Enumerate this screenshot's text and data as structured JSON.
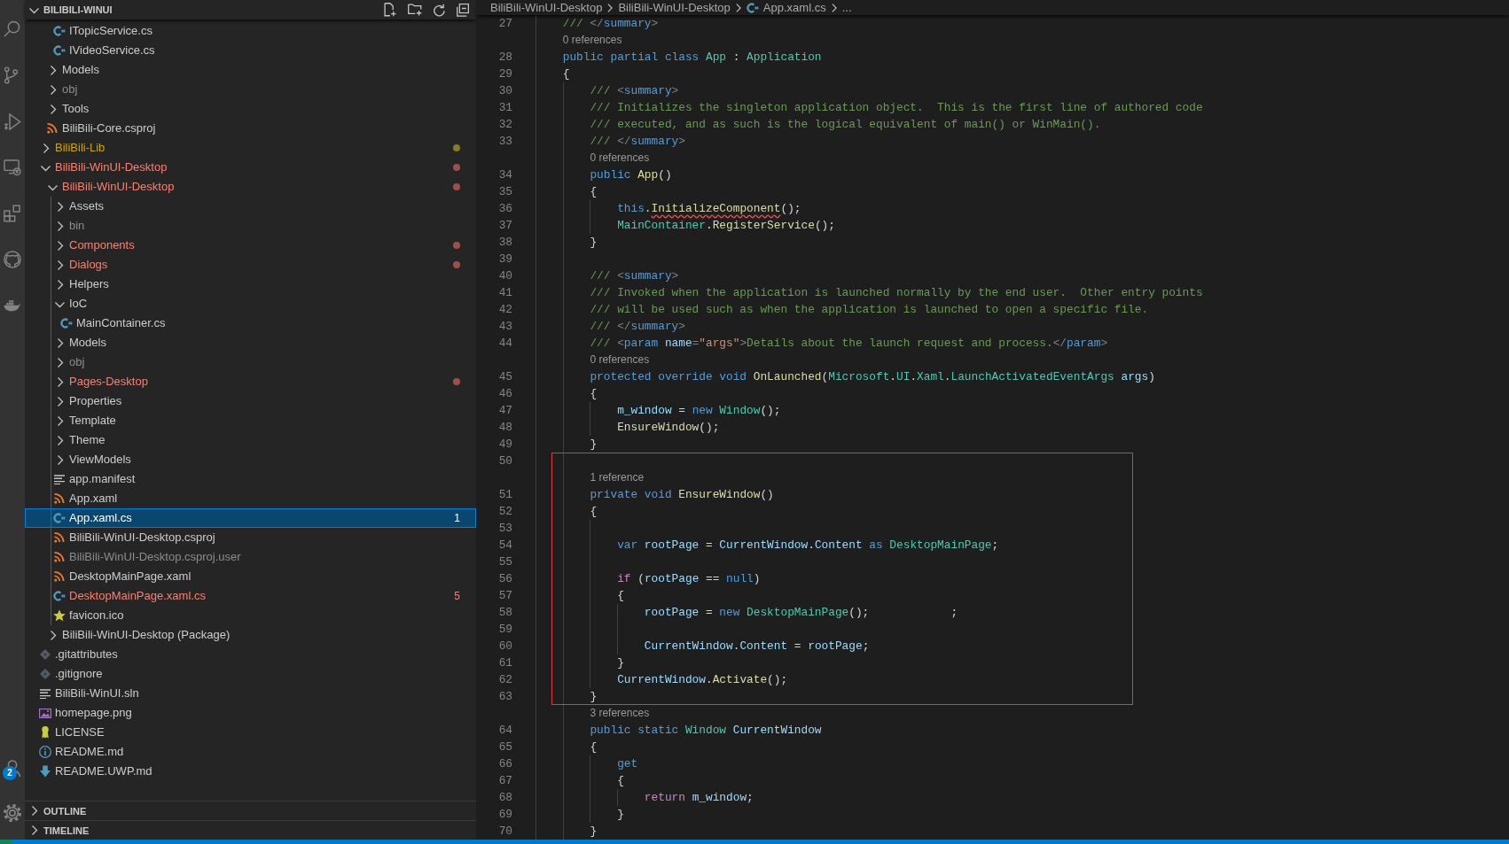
{
  "activity_bar": {
    "accounts_badge": "2"
  },
  "explorer": {
    "title": "BILIBILI-WINUI",
    "expanded": true,
    "tree": [
      {
        "kind": "offscreen",
        "children": [
          {
            "kind": "offscreen",
            "children": [
              {
                "label": "ITopicService.cs",
                "kind": "csharp",
                "selected": false,
                "errors": false,
                "warnings": false,
                "ignored": false
              },
              {
                "label": "IVideoService.cs",
                "kind": "csharp",
                "selected": false,
                "errors": false,
                "warnings": false,
                "ignored": false
              }
            ]
          },
          {
            "label": "Models",
            "kind": "folder",
            "expanded": false,
            "selected": false,
            "errors": false,
            "warnings": false,
            "ignored": false
          },
          {
            "label": "obj",
            "kind": "folder",
            "expanded": false,
            "selected": false,
            "errors": false,
            "warnings": false,
            "ignored": true
          },
          {
            "label": "Tools",
            "kind": "folder",
            "expanded": false,
            "selected": false,
            "errors": false,
            "warnings": false,
            "ignored": false
          },
          {
            "label": "BiliBili-Core.csproj",
            "kind": "xml",
            "selected": false,
            "errors": false,
            "warnings": false,
            "ignored": false
          }
        ]
      },
      {
        "label": "BiliBili-Lib",
        "kind": "folder",
        "expanded": false,
        "selected": false,
        "errors": false,
        "warnings": true,
        "ignored": false
      },
      {
        "label": "BiliBili-WinUI-Desktop",
        "kind": "folder",
        "expanded": true,
        "selected": false,
        "errors": true,
        "warnings": false,
        "ignored": false,
        "children": [
          {
            "label": "BiliBili-WinUI-Desktop",
            "kind": "folder",
            "expanded": true,
            "selected": false,
            "errors": true,
            "warnings": false,
            "ignored": false,
            "children": [
              {
                "label": "Assets",
                "kind": "folder",
                "expanded": false,
                "selected": false,
                "errors": false,
                "warnings": false,
                "ignored": false
              },
              {
                "label": "bin",
                "kind": "folder",
                "expanded": false,
                "selected": false,
                "errors": false,
                "warnings": false,
                "ignored": true
              },
              {
                "label": "Components",
                "kind": "folder",
                "expanded": false,
                "selected": false,
                "errors": true,
                "warnings": false,
                "ignored": false
              },
              {
                "label": "Dialogs",
                "kind": "folder",
                "expanded": false,
                "selected": false,
                "errors": true,
                "warnings": false,
                "ignored": false
              },
              {
                "label": "Helpers",
                "kind": "folder",
                "expanded": false,
                "selected": false,
                "errors": false,
                "warnings": false,
                "ignored": false
              },
              {
                "label": "IoC",
                "kind": "folder",
                "expanded": true,
                "selected": false,
                "errors": false,
                "warnings": false,
                "ignored": false,
                "children": [
                  {
                    "label": "MainContainer.cs",
                    "kind": "csharp",
                    "selected": false,
                    "errors": false,
                    "warnings": false,
                    "ignored": false
                  }
                ]
              },
              {
                "label": "Models",
                "kind": "folder",
                "expanded": false,
                "selected": false,
                "errors": false,
                "warnings": false,
                "ignored": false
              },
              {
                "label": "obj",
                "kind": "folder",
                "expanded": false,
                "selected": false,
                "errors": false,
                "warnings": false,
                "ignored": true
              },
              {
                "label": "Pages-Desktop",
                "kind": "folder",
                "expanded": false,
                "selected": false,
                "errors": true,
                "warnings": false,
                "ignored": false
              },
              {
                "label": "Properties",
                "kind": "folder",
                "expanded": false,
                "selected": false,
                "errors": false,
                "warnings": false,
                "ignored": false
              },
              {
                "label": "Template",
                "kind": "folder",
                "expanded": false,
                "selected": false,
                "errors": false,
                "warnings": false,
                "ignored": false
              },
              {
                "label": "Theme",
                "kind": "folder",
                "expanded": false,
                "selected": false,
                "errors": false,
                "warnings": false,
                "ignored": false
              },
              {
                "label": "ViewModels",
                "kind": "folder",
                "expanded": false,
                "selected": false,
                "errors": false,
                "warnings": false,
                "ignored": false
              },
              {
                "label": "app.manifest",
                "kind": "text",
                "selected": false,
                "errors": false,
                "warnings": false,
                "ignored": false
              },
              {
                "label": "App.xaml",
                "kind": "xml",
                "selected": false,
                "errors": false,
                "warnings": false,
                "ignored": false
              },
              {
                "label": "App.xaml.cs",
                "kind": "csharp",
                "selected": true,
                "errors": true,
                "warnings": false,
                "ignored": false,
                "badge": "1"
              },
              {
                "label": "BiliBili-WinUI-Desktop.csproj",
                "kind": "xml",
                "selected": false,
                "errors": false,
                "warnings": false,
                "ignored": false
              },
              {
                "label": "BiliBili-WinUI-Desktop.csproj.user",
                "kind": "xml",
                "selected": false,
                "errors": false,
                "warnings": false,
                "ignored": true
              },
              {
                "label": "DesktopMainPage.xaml",
                "kind": "xml",
                "selected": false,
                "errors": false,
                "warnings": false,
                "ignored": false
              },
              {
                "label": "DesktopMainPage.xaml.cs",
                "kind": "csharp",
                "selected": false,
                "errors": true,
                "warnings": false,
                "ignored": false,
                "badge": "5"
              },
              {
                "label": "favicon.ico",
                "kind": "star",
                "selected": false,
                "errors": false,
                "warnings": false,
                "ignored": false
              }
            ]
          },
          {
            "label": "BiliBili-WinUI-Desktop (Package)",
            "kind": "folder",
            "expanded": false,
            "selected": false,
            "errors": false,
            "warnings": false,
            "ignored": false
          }
        ]
      },
      {
        "label": ".gitattributes",
        "kind": "git",
        "selected": false,
        "errors": false,
        "warnings": false,
        "ignored": false
      },
      {
        "label": ".gitignore",
        "kind": "git",
        "selected": false,
        "errors": false,
        "warnings": false,
        "ignored": false
      },
      {
        "label": "BiliBili-WinUI.sln",
        "kind": "text",
        "selected": false,
        "errors": false,
        "warnings": false,
        "ignored": false
      },
      {
        "label": "homepage.png",
        "kind": "image",
        "selected": false,
        "errors": false,
        "warnings": false,
        "ignored": false
      },
      {
        "label": "LICENSE",
        "kind": "license",
        "selected": false,
        "errors": false,
        "warnings": false,
        "ignored": false
      },
      {
        "label": "README.md",
        "kind": "info",
        "selected": false,
        "errors": false,
        "warnings": false,
        "ignored": false
      },
      {
        "label": "README.UWP.md",
        "kind": "markdown",
        "selected": false,
        "errors": false,
        "warnings": false,
        "ignored": false
      }
    ],
    "panes": [
      {
        "title": "OUTLINE",
        "expanded": false
      },
      {
        "title": "TIMELINE",
        "expanded": false
      }
    ]
  },
  "editor": {
    "breadcrumbs": [
      {
        "label": "BiliBili-WinUI-Desktop",
        "kind": "folder"
      },
      {
        "label": "BiliBili-WinUI-Desktop",
        "kind": "folder"
      },
      {
        "label": "App.xaml.cs",
        "kind": "csharp"
      },
      {
        "label": "...",
        "kind": "more"
      }
    ],
    "lines": [
      {
        "kind": "offscreen",
        "children": [
          {
            "kind": "code",
            "number": "27",
            "tokens": [
              {
                "kind": "comment",
                "text": "/// "
              },
              {
                "kind": "punct",
                "text": "</"
              },
              {
                "kind": "tag",
                "text": "summary"
              },
              {
                "kind": "punct",
                "text": ">"
              }
            ]
          },
          {
            "kind": "lens",
            "text": "0 references"
          },
          {
            "kind": "code",
            "number": "28",
            "tokens": [
              {
                "kind": "kw",
                "text": "public partial class "
              },
              {
                "kind": "type",
                "text": "App"
              },
              {
                "kind": "plain",
                "text": " : "
              },
              {
                "kind": "type",
                "text": "Application"
              }
            ]
          },
          {
            "kind": "code",
            "number": "29",
            "tokens": [
              {
                "kind": "plain",
                "text": "{"
              }
            ],
            "children": [
              {
                "kind": "code",
                "number": "30",
                "tokens": [
                  {
                    "kind": "comment",
                    "text": "/// "
                  },
                  {
                    "kind": "punct",
                    "text": "<"
                  },
                  {
                    "kind": "tag",
                    "text": "summary"
                  },
                  {
                    "kind": "punct",
                    "text": ">"
                  }
                ]
              },
              {
                "kind": "code",
                "number": "31",
                "tokens": [
                  {
                    "kind": "comment",
                    "text": "/// Initializes the singleton application object.  This is the first line of authored code"
                  }
                ]
              },
              {
                "kind": "code",
                "number": "32",
                "tokens": [
                  {
                    "kind": "comment",
                    "text": "/// executed, and as such is the logical equivalent of main() or WinMain()."
                  }
                ]
              },
              {
                "kind": "code",
                "number": "33",
                "tokens": [
                  {
                    "kind": "comment",
                    "text": "/// "
                  },
                  {
                    "kind": "punct",
                    "text": "</"
                  },
                  {
                    "kind": "tag",
                    "text": "summary"
                  },
                  {
                    "kind": "punct",
                    "text": ">"
                  }
                ]
              },
              {
                "kind": "lens",
                "text": "0 references"
              },
              {
                "kind": "code",
                "number": "34",
                "tokens": [
                  {
                    "kind": "kw",
                    "text": "public "
                  },
                  {
                    "kind": "fn",
                    "text": "App"
                  },
                  {
                    "kind": "plain",
                    "text": "()"
                  }
                ]
              },
              {
                "kind": "code",
                "number": "35",
                "tokens": [
                  {
                    "kind": "plain",
                    "text": "{"
                  }
                ],
                "children": [
                  {
                    "kind": "code",
                    "number": "36",
                    "tokens": [
                      {
                        "kind": "kw",
                        "text": "this"
                      },
                      {
                        "kind": "plain",
                        "text": "."
                      },
                      {
                        "kind": "error",
                        "text": "InitializeComponent"
                      },
                      {
                        "kind": "plain",
                        "text": "();"
                      }
                    ]
                  },
                  {
                    "kind": "code",
                    "number": "37",
                    "tokens": [
                      {
                        "kind": "type",
                        "text": "MainContainer"
                      },
                      {
                        "kind": "plain",
                        "text": "."
                      },
                      {
                        "kind": "fn",
                        "text": "RegisterService"
                      },
                      {
                        "kind": "plain",
                        "text": "();"
                      }
                    ]
                  }
                ]
              },
              {
                "kind": "code",
                "number": "38",
                "tokens": [
                  {
                    "kind": "plain",
                    "text": "}"
                  }
                ]
              },
              {
                "kind": "code",
                "number": "39"
              },
              {
                "kind": "code",
                "number": "40",
                "tokens": [
                  {
                    "kind": "comment",
                    "text": "/// "
                  },
                  {
                    "kind": "punct",
                    "text": "<"
                  },
                  {
                    "kind": "tag",
                    "text": "summary"
                  },
                  {
                    "kind": "punct",
                    "text": ">"
                  }
                ]
              },
              {
                "kind": "code",
                "number": "41",
                "tokens": [
                  {
                    "kind": "comment",
                    "text": "/// Invoked when the application is launched normally by the end user.  Other entry points"
                  }
                ]
              },
              {
                "kind": "code",
                "number": "42",
                "tokens": [
                  {
                    "kind": "comment",
                    "text": "/// will be used such as when the application is launched to open a specific file."
                  }
                ]
              },
              {
                "kind": "code",
                "number": "43",
                "tokens": [
                  {
                    "kind": "comment",
                    "text": "/// "
                  },
                  {
                    "kind": "punct",
                    "text": "</"
                  },
                  {
                    "kind": "tag",
                    "text": "summary"
                  },
                  {
                    "kind": "punct",
                    "text": ">"
                  }
                ]
              },
              {
                "kind": "code",
                "number": "44",
                "tokens": [
                  {
                    "kind": "comment",
                    "text": "/// "
                  },
                  {
                    "kind": "punct",
                    "text": "<"
                  },
                  {
                    "kind": "tag",
                    "text": "param "
                  },
                  {
                    "kind": "attr",
                    "text": "name"
                  },
                  {
                    "kind": "punct",
                    "text": "="
                  },
                  {
                    "kind": "str",
                    "text": "\"args\""
                  },
                  {
                    "kind": "punct",
                    "text": ">"
                  },
                  {
                    "kind": "comment",
                    "text": "Details about the launch request and process."
                  },
                  {
                    "kind": "punct",
                    "text": "</"
                  },
                  {
                    "kind": "tag",
                    "text": "param"
                  },
                  {
                    "kind": "punct",
                    "text": ">"
                  }
                ]
              },
              {
                "kind": "lens",
                "text": "0 references"
              },
              {
                "kind": "code",
                "number": "45",
                "tokens": [
                  {
                    "kind": "kw",
                    "text": "protected override void "
                  },
                  {
                    "kind": "fn",
                    "text": "OnLaunched"
                  },
                  {
                    "kind": "plain",
                    "text": "("
                  },
                  {
                    "kind": "type",
                    "text": "Microsoft"
                  },
                  {
                    "kind": "plain",
                    "text": "."
                  },
                  {
                    "kind": "type",
                    "text": "UI"
                  },
                  {
                    "kind": "plain",
                    "text": "."
                  },
                  {
                    "kind": "type",
                    "text": "Xaml"
                  },
                  {
                    "kind": "plain",
                    "text": "."
                  },
                  {
                    "kind": "type",
                    "text": "LaunchActivatedEventArgs "
                  },
                  {
                    "kind": "var",
                    "text": "args"
                  },
                  {
                    "kind": "plain",
                    "text": ")"
                  }
                ]
              },
              {
                "kind": "code",
                "number": "46",
                "tokens": [
                  {
                    "kind": "plain",
                    "text": "{"
                  }
                ],
                "children": [
                  {
                    "kind": "code",
                    "number": "47",
                    "tokens": [
                      {
                        "kind": "var",
                        "text": "m_window"
                      },
                      {
                        "kind": "plain",
                        "text": " = "
                      },
                      {
                        "kind": "kw",
                        "text": "new "
                      },
                      {
                        "kind": "type",
                        "text": "Window"
                      },
                      {
                        "kind": "plain",
                        "text": "();"
                      }
                    ]
                  },
                  {
                    "kind": "code",
                    "number": "48",
                    "tokens": [
                      {
                        "kind": "fn",
                        "text": "EnsureWindow"
                      },
                      {
                        "kind": "plain",
                        "text": "();"
                      }
                    ]
                  }
                ]
              },
              {
                "kind": "code",
                "number": "49",
                "tokens": [
                  {
                    "kind": "plain",
                    "text": "}"
                  }
                ]
              },
              {
                "kind": "frame",
                "children": [
                  {
                    "kind": "code",
                    "number": "50"
                  },
                  {
                    "kind": "lens",
                    "text": "1 reference"
                  },
                  {
                    "kind": "code",
                    "number": "51",
                    "tokens": [
                      {
                        "kind": "kw",
                        "text": "private void "
                      },
                      {
                        "kind": "fn",
                        "text": "EnsureWindow"
                      },
                      {
                        "kind": "plain",
                        "text": "()"
                      }
                    ]
                  },
                  {
                    "kind": "code",
                    "number": "52",
                    "tokens": [
                      {
                        "kind": "plain",
                        "text": "{"
                      }
                    ],
                    "children": [
                      {
                        "kind": "code",
                        "number": "53"
                      },
                      {
                        "kind": "code",
                        "number": "54",
                        "tokens": [
                          {
                            "kind": "kw",
                            "text": "var "
                          },
                          {
                            "kind": "var",
                            "text": "rootPage"
                          },
                          {
                            "kind": "plain",
                            "text": " = "
                          },
                          {
                            "kind": "var",
                            "text": "CurrentWindow"
                          },
                          {
                            "kind": "plain",
                            "text": "."
                          },
                          {
                            "kind": "var",
                            "text": "Content "
                          },
                          {
                            "kind": "kw",
                            "text": "as "
                          },
                          {
                            "kind": "type",
                            "text": "DesktopMainPage"
                          },
                          {
                            "kind": "plain",
                            "text": ";"
                          }
                        ]
                      },
                      {
                        "kind": "code",
                        "number": "55"
                      },
                      {
                        "kind": "code",
                        "number": "56",
                        "tokens": [
                          {
                            "kind": "ctl",
                            "text": "if "
                          },
                          {
                            "kind": "plain",
                            "text": "("
                          },
                          {
                            "kind": "var",
                            "text": "rootPage"
                          },
                          {
                            "kind": "plain",
                            "text": " == "
                          },
                          {
                            "kind": "kw",
                            "text": "null"
                          },
                          {
                            "kind": "plain",
                            "text": ")"
                          }
                        ]
                      },
                      {
                        "kind": "code",
                        "number": "57",
                        "tokens": [
                          {
                            "kind": "plain",
                            "text": "{"
                          }
                        ],
                        "children": [
                          {
                            "kind": "code",
                            "number": "58",
                            "tokens": [
                              {
                                "kind": "var",
                                "text": "rootPage"
                              },
                              {
                                "kind": "plain",
                                "text": " = "
                              },
                              {
                                "kind": "kw",
                                "text": "new "
                              },
                              {
                                "kind": "type",
                                "text": "DesktopMainPage"
                              },
                              {
                                "kind": "plain",
                                "text": "();            ;"
                              }
                            ]
                          },
                          {
                            "kind": "code",
                            "number": "59"
                          },
                          {
                            "kind": "code",
                            "number": "60",
                            "tokens": [
                              {
                                "kind": "var",
                                "text": "CurrentWindow"
                              },
                              {
                                "kind": "plain",
                                "text": "."
                              },
                              {
                                "kind": "var",
                                "text": "Content"
                              },
                              {
                                "kind": "plain",
                                "text": " = "
                              },
                              {
                                "kind": "var",
                                "text": "rootPage"
                              },
                              {
                                "kind": "plain",
                                "text": ";"
                              }
                            ]
                          }
                        ]
                      },
                      {
                        "kind": "code",
                        "number": "61",
                        "tokens": [
                          {
                            "kind": "plain",
                            "text": "}"
                          }
                        ]
                      },
                      {
                        "kind": "code",
                        "number": "62",
                        "tokens": [
                          {
                            "kind": "var",
                            "text": "CurrentWindow"
                          },
                          {
                            "kind": "plain",
                            "text": "."
                          },
                          {
                            "kind": "fn",
                            "text": "Activate"
                          },
                          {
                            "kind": "plain",
                            "text": "();"
                          }
                        ]
                      }
                    ]
                  },
                  {
                    "kind": "code",
                    "number": "63",
                    "tokens": [
                      {
                        "kind": "plain",
                        "text": "}"
                      }
                    ]
                  }
                ]
              },
              {
                "kind": "lens",
                "text": "3 references"
              },
              {
                "kind": "code",
                "number": "64",
                "tokens": [
                  {
                    "kind": "kw",
                    "text": "public static "
                  },
                  {
                    "kind": "type",
                    "text": "Window "
                  },
                  {
                    "kind": "var",
                    "text": "CurrentWindow"
                  }
                ]
              },
              {
                "kind": "code",
                "number": "65",
                "tokens": [
                  {
                    "kind": "plain",
                    "text": "{"
                  }
                ],
                "children": [
                  {
                    "kind": "code",
                    "number": "66",
                    "tokens": [
                      {
                        "kind": "kw",
                        "text": "get"
                      }
                    ]
                  },
                  {
                    "kind": "code",
                    "number": "67",
                    "tokens": [
                      {
                        "kind": "plain",
                        "text": "{"
                      }
                    ],
                    "children": [
                      {
                        "kind": "code",
                        "number": "68",
                        "tokens": [
                          {
                            "kind": "ctl",
                            "text": "return "
                          },
                          {
                            "kind": "var",
                            "text": "m_window"
                          },
                          {
                            "kind": "plain",
                            "text": ";"
                          }
                        ]
                      }
                    ]
                  },
                  {
                    "kind": "code",
                    "number": "69",
                    "tokens": [
                      {
                        "kind": "plain",
                        "text": "}"
                      }
                    ]
                  }
                ]
              },
              {
                "kind": "code",
                "number": "70",
                "tokens": [
                  {
                    "kind": "plain",
                    "text": "}"
                  }
                ]
              }
            ]
          }
        ]
      }
    ]
  }
}
